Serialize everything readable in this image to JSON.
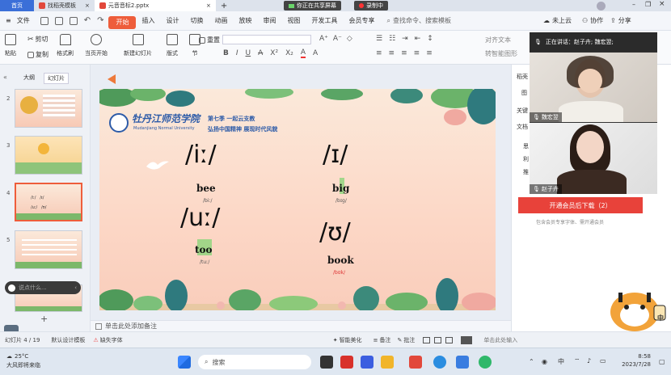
{
  "titlebar": {
    "home_tab": "首页",
    "tab1": "找稻壳模板",
    "tab2": "元音音标2.pptx",
    "sharing": "你正在共享屏幕",
    "recording": "录制中"
  },
  "menu": {
    "file": "文件",
    "items": [
      "开始",
      "插入",
      "设计",
      "切换",
      "动画",
      "放映",
      "审阅",
      "视图",
      "开发工具",
      "会员专享"
    ],
    "search": "查找命令、搜索模板",
    "cloud": "未上云",
    "collab": "协作",
    "share": "分享"
  },
  "ribbon": {
    "paste": "粘贴",
    "cut": "剪切",
    "copy": "复制",
    "format_painter": "格式刷",
    "play_current": "当页开始",
    "new_slide": "新建幻灯片",
    "layout": "版式",
    "section": "节",
    "reset": "重置",
    "text_direction": "对齐文本",
    "arrange": "转智能图形"
  },
  "left_panel": {
    "outline": "大纲",
    "slides": "幻灯片",
    "numbers": [
      "2",
      "3",
      "4",
      "5"
    ],
    "say_placeholder": "说点什么..."
  },
  "slide": {
    "school": "牡丹江师范学院",
    "school_en": "Mudanjiang Normal University",
    "headline1": "第七季 一起云支教",
    "headline2": "弘扬中国精神 展现时代风貌",
    "ipa1": "/iː/",
    "word1": "bee",
    "small1": "/biː/",
    "ipa2": "/ɪ/",
    "word2": "big",
    "small2": "/bɪg/",
    "ipa3": "/uː/",
    "word3": "too",
    "small3": "/tuː/",
    "ipa4": "/ʊ/",
    "word4": "book",
    "small4": "/bʊk/"
  },
  "video": {
    "speaking": "正在讲话：赵子卉; 魏宏翌;",
    "person1": "魏宏翌",
    "person2": "赵子卉"
  },
  "right_panel": {
    "labels": [
      "稻壳",
      "图",
      "关键",
      "文档",
      "思",
      "利",
      "推"
    ],
    "vip_button": "开通会员后下载（2）",
    "vip_note": "包含会员专享字体、需开通会员"
  },
  "notes": {
    "placeholder": "单击此处添加备注"
  },
  "status": {
    "slide_counter": "幻灯片 4 / 19",
    "design": "默认设计模板",
    "font_missing": "缺失字体",
    "beautify": "智能美化",
    "notes": "备注",
    "comment": "批注",
    "zoom_hint": "单击此处输入"
  },
  "taskbar": {
    "temp": "25°C",
    "weather": "大风即将来临",
    "search": "搜索",
    "time": "8:58",
    "date": "2023/7/28",
    "lang": "中"
  }
}
